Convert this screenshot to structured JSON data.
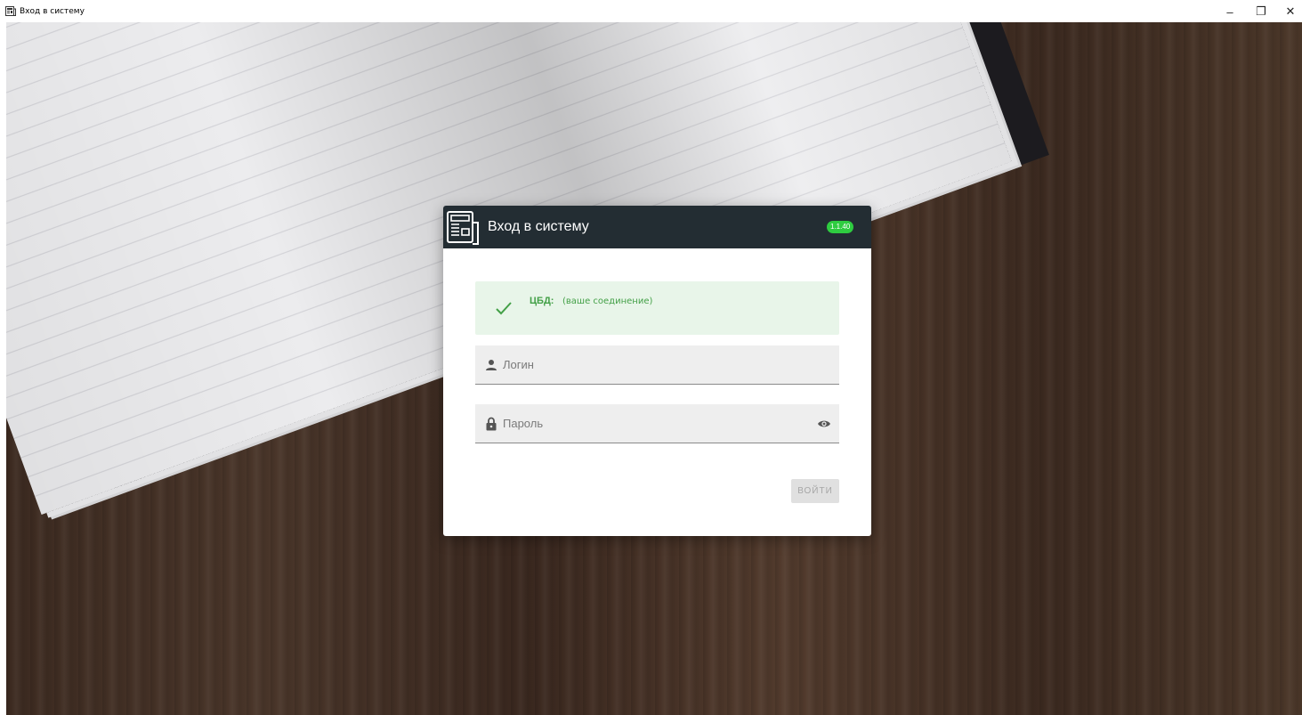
{
  "window": {
    "title": "Вход в систему",
    "controls": {
      "minimize": "–",
      "restore": "❐",
      "close": "✕"
    }
  },
  "dialog": {
    "title": "Вход в систему",
    "version": "1.1.40",
    "status": {
      "label": "ЦБД:",
      "value": "(ваше соединение)",
      "icon": "check-icon",
      "color": "#43a047"
    },
    "login_field": {
      "placeholder": "Логин",
      "value": "",
      "icon": "person-icon"
    },
    "password_field": {
      "placeholder": "Пароль",
      "value": "",
      "icon": "lock-icon",
      "toggle_icon": "eye-icon"
    },
    "submit_label": "ВОЙТИ"
  },
  "colors": {
    "header_bg": "#232d33",
    "version_badge": "#2ecc40",
    "status_bg": "#e8f5e9",
    "field_bg": "#eeeeee"
  }
}
